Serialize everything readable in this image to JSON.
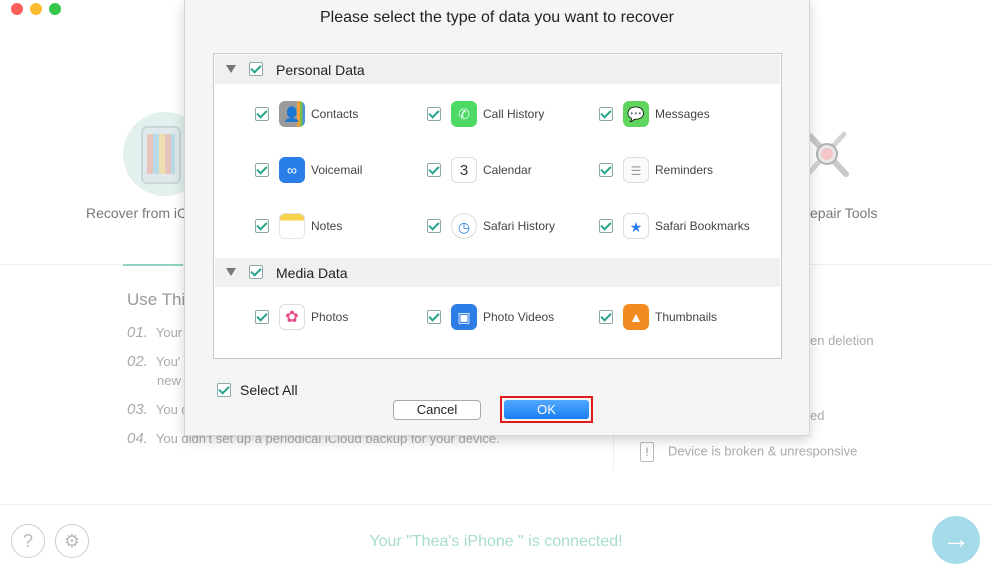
{
  "background": {
    "left_card_label": "Recover from iC",
    "right_card_label": "epair Tools",
    "heading": "Use Thi",
    "steps": [
      {
        "num": "01.",
        "text": "Your"
      },
      {
        "num": "02.",
        "text": "You'"
      },
      {
        "num": "",
        "text": "new"
      },
      {
        "num": "03.",
        "text": "You d"
      },
      {
        "num": "04.",
        "text": "You didn't set up a periodical iCloud backup for your device."
      }
    ],
    "right_items": [
      "en deletion",
      "ed",
      "Device is broken & unresponsive"
    ],
    "warn_glyph": "!",
    "status": "Your \"Thea's iPhone \" is connected!"
  },
  "modal": {
    "title": "Please select the type of data you want to recover",
    "groups": [
      {
        "label": "Personal Data",
        "items": [
          {
            "label": "Contacts",
            "icon": "contacts-icon"
          },
          {
            "label": "Call History",
            "icon": "phone-icon"
          },
          {
            "label": "Messages",
            "icon": "messages-icon"
          },
          {
            "label": "Voicemail",
            "icon": "voicemail-icon"
          },
          {
            "label": "Calendar",
            "icon": "calendar-icon"
          },
          {
            "label": "Reminders",
            "icon": "reminders-icon"
          },
          {
            "label": "Notes",
            "icon": "notes-icon"
          },
          {
            "label": "Safari History",
            "icon": "safari-history-icon"
          },
          {
            "label": "Safari Bookmarks",
            "icon": "safari-bookmarks-icon"
          }
        ]
      },
      {
        "label": "Media Data",
        "items": [
          {
            "label": "Photos",
            "icon": "photos-icon"
          },
          {
            "label": "Photo Videos",
            "icon": "photo-videos-icon"
          },
          {
            "label": "Thumbnails",
            "icon": "thumbnails-icon"
          }
        ]
      }
    ],
    "calendar_day": "3",
    "select_all": "Select All",
    "cancel": "Cancel",
    "ok": "OK"
  },
  "colors": {
    "accent": "#27a48e",
    "ok_button": "#1a7df2",
    "highlight": "#e01b1b"
  }
}
